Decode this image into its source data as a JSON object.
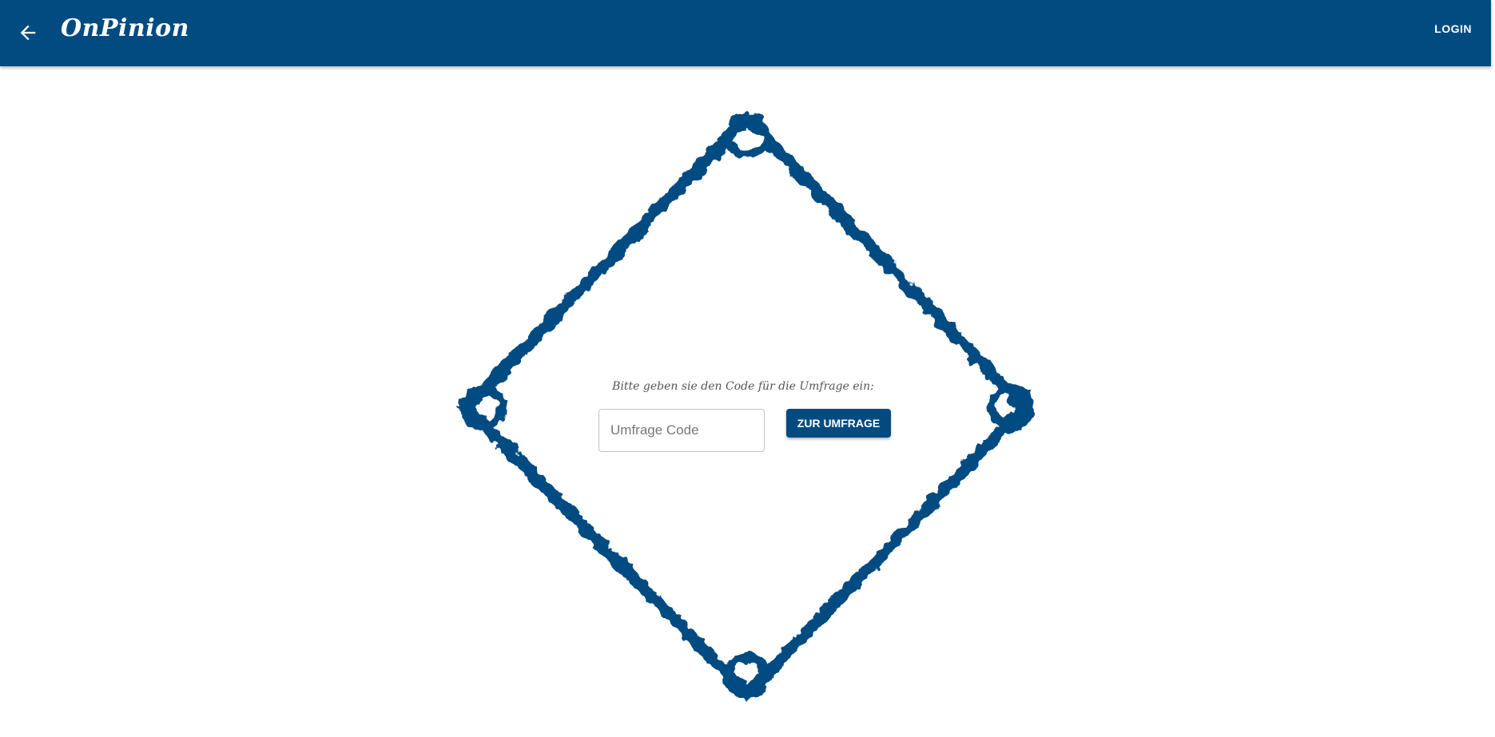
{
  "header": {
    "title": "OnPinion",
    "login_label": "LOGIN"
  },
  "main": {
    "prompt": "Bitte geben sie den Code für die Umfrage ein:",
    "code_input": {
      "placeholder": "Umfrage Code",
      "value": ""
    },
    "submit_label": "ZUR UMFRAGE"
  },
  "colors": {
    "brand": "#024b81",
    "background": "#ffffff"
  },
  "icons": {
    "back": "arrow-left-icon"
  }
}
